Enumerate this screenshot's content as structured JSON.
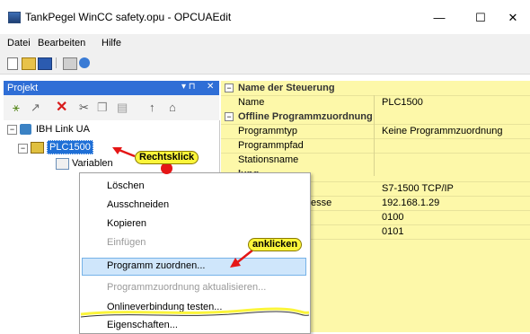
{
  "window": {
    "title": "TankPegel WinCC safety.opu - OPCUAEdit",
    "minimize": "—",
    "maximize": "☐",
    "close": "✕"
  },
  "menu": [
    "Datei",
    "Bearbeiten",
    "Hilfe"
  ],
  "project_panel": {
    "title": "Projekt",
    "pin": "▾ ⊓",
    "close": "✕"
  },
  "tree": {
    "root": "IBH Link UA",
    "plc": "PLC1500",
    "child": "Variablen"
  },
  "properties": {
    "cat1": "Name der Steuerung",
    "name_label": "Name",
    "name_value": "PLC1500",
    "cat2": "Offline Programmzuordnung",
    "programmtyp_label": "Programmtyp",
    "programmtyp_value": "Keine Programmzuordnung",
    "programmpfad_label": "Programmpfad",
    "stationsname_label": "Stationsname",
    "cat3_partial": "lung",
    "val_protocol": "S7-1500 TCP/IP",
    "addr_label_partial": "esse",
    "val_ip": "192.168.1.29",
    "val_a": "0100",
    "val_b": "0101"
  },
  "context_menu": {
    "loeschen": "Löschen",
    "ausschneiden": "Ausschneiden",
    "kopieren": "Kopieren",
    "einfuegen": "Einfügen",
    "programm_zuordnen": "Programm zuordnen...",
    "aktualisieren": "Programmzuordnung aktualisieren...",
    "online_testen": "Onlineverbindung testen...",
    "eigenschaften": "Eigenschaften..."
  },
  "annotations": {
    "rechtsklick": "Rechtsklick",
    "anklicken": "anklicken"
  },
  "colors": {
    "highlight_yellow": "#fbf53a",
    "property_bg": "#fdf8a9",
    "panel_header": "#2f6ed6",
    "menu_selection": "#cfe6fb",
    "arrow_red": "#e51616"
  }
}
